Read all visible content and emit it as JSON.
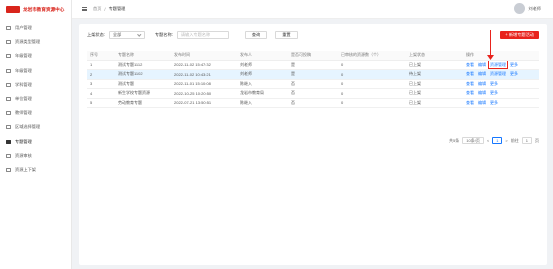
{
  "app": {
    "title": "龙岩市教育资源中心"
  },
  "sidebar": {
    "items": [
      {
        "label": "用户管理",
        "icon": "user-icon"
      },
      {
        "label": "资源类型管理",
        "icon": "folder-icon"
      },
      {
        "label": "年级管理",
        "icon": "grade-icon"
      },
      {
        "label": "年级管理",
        "icon": "grade-icon"
      },
      {
        "label": "学科管理",
        "icon": "subject-icon"
      },
      {
        "label": "单位管理",
        "icon": "building-icon"
      },
      {
        "label": "教师管理",
        "icon": "teacher-icon"
      },
      {
        "label": "区域选择管理",
        "icon": "map-icon"
      },
      {
        "label": "专题管理",
        "icon": "topic-icon",
        "active": true
      },
      {
        "label": "资源审核",
        "icon": "audit-icon"
      },
      {
        "label": "资源上下架",
        "icon": "shelf-icon"
      }
    ]
  },
  "topbar": {
    "breadcrumb": [
      "首页",
      "/",
      "专题管理"
    ],
    "user": "刘老师"
  },
  "filters": {
    "status_label": "上架状态:",
    "status_value": "全部",
    "name_label": "专题名称:",
    "name_placeholder": "请输入专题名称",
    "search_button": "查询",
    "reset_button": "重置",
    "add_button": "+ 新增专题活动"
  },
  "table": {
    "headers": [
      "序号",
      "专题名称",
      "发布时间",
      "发布人",
      "是否可投稿",
      "已审核的资源数（个）",
      "上架状态",
      "操作"
    ],
    "rows": [
      {
        "no": "1",
        "name": "测试专题1112",
        "time": "2022-11-02 15:47:32",
        "by": "刘老师",
        "submit": "是",
        "count": "0",
        "status": "已上架",
        "ops": [
          "查看",
          "编辑",
          "资源管理",
          "更多"
        ]
      },
      {
        "no": "2",
        "name": "测试专题1102",
        "time": "2022-11-02 10:43:21",
        "by": "刘老师",
        "submit": "是",
        "count": "0",
        "status": "待上架",
        "ops": [
          "查看",
          "编辑",
          "资源管理",
          "更多"
        ]
      },
      {
        "no": "3",
        "name": "测试专题",
        "time": "2022-11-01 15:10:08",
        "by": "陈继入",
        "submit": "否",
        "count": "0",
        "status": "已上架",
        "ops": [
          "查看",
          "编辑",
          "更多"
        ]
      },
      {
        "no": "4",
        "name": "新生学校专题资源",
        "time": "2022-10-25 10:20:50",
        "by": "龙岩市教育局",
        "submit": "否",
        "count": "0",
        "status": "已上架",
        "ops": [
          "查看",
          "编辑",
          "更多"
        ]
      },
      {
        "no": "5",
        "name": "劳动教育专题",
        "time": "2022-07-21 13:50:51",
        "by": "陈继入",
        "submit": "否",
        "count": "0",
        "status": "已上架",
        "ops": [
          "查看",
          "编辑",
          "更多"
        ]
      }
    ]
  },
  "pager": {
    "total": "共5条",
    "size": "10条/页",
    "prev": "<",
    "page": "1",
    "next": ">",
    "goto": "前往",
    "page_input": "1",
    "unit": "页"
  }
}
